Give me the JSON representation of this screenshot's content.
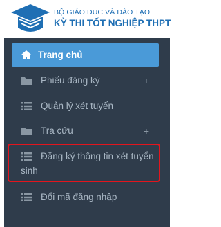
{
  "header": {
    "org_name": "BỘ GIÁO DỤC VÀ ĐÀO TẠO",
    "system_name": "KỲ THI TỐT NGHIỆP THPT"
  },
  "menu": {
    "items": [
      {
        "label": "Trang chủ",
        "icon": "home-icon",
        "active": true
      },
      {
        "label": "Phiếu đăng ký",
        "icon": "folder-icon",
        "expand": "+"
      },
      {
        "label": "Quản lý xét tuyển",
        "icon": "list-icon"
      },
      {
        "label": "Tra cứu",
        "icon": "folder-icon",
        "expand": "+"
      },
      {
        "label_line1": "Đăng ký thông tin xét tuyển",
        "label_line2": "sinh",
        "icon": "list-icon",
        "highlighted": true
      },
      {
        "label": "Đổi mã đăng nhập",
        "icon": "list-icon"
      }
    ]
  },
  "colors": {
    "sidebar_bg": "#2f3c4b",
    "active_bg": "#4a9ad8",
    "brand_blue": "#1f6fb4",
    "highlight_border": "#e3151d"
  }
}
